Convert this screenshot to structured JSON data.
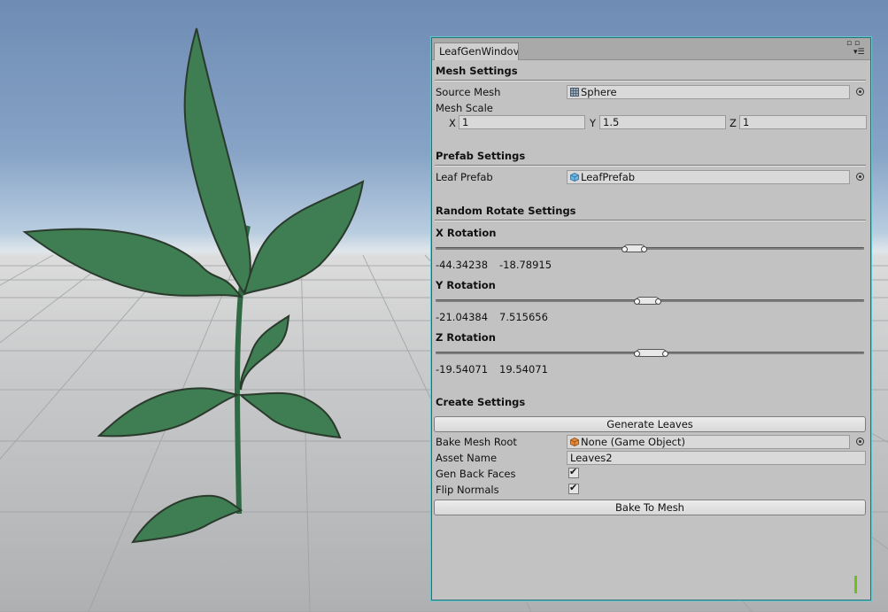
{
  "window": {
    "tab_title": "LeafGenWindov",
    "menu_icons": [
      "lock-icon",
      "maximize-icon",
      "dropdown-menu-icon"
    ]
  },
  "mesh_settings": {
    "header": "Mesh Settings",
    "source_mesh": {
      "label": "Source Mesh",
      "value": "Sphere",
      "icon": "mesh-icon"
    },
    "mesh_scale": {
      "label": "Mesh Scale",
      "x": {
        "label": "X",
        "value": "1"
      },
      "y": {
        "label": "Y",
        "value": "1.5"
      },
      "z": {
        "label": "Z",
        "value": "1"
      }
    }
  },
  "prefab_settings": {
    "header": "Prefab Settings",
    "leaf_prefab": {
      "label": "Leaf Prefab",
      "value": "LeafPrefab",
      "icon": "prefab-cube-icon"
    }
  },
  "random_rotate_settings": {
    "header": "Random Rotate Settings",
    "x_rotation": {
      "label": "X Rotation",
      "min": "-44.34238",
      "max": "-18.78915"
    },
    "y_rotation": {
      "label": "Y Rotation",
      "min": "-21.04384",
      "max": "7.515656"
    },
    "z_rotation": {
      "label": "Z Rotation",
      "min": "-19.54071",
      "max": "19.54071"
    }
  },
  "create_settings": {
    "header": "Create Settings",
    "generate_button": "Generate Leaves",
    "bake_mesh_root": {
      "label": "Bake Mesh Root",
      "value": "None (Game Object)",
      "icon": "game-object-icon"
    },
    "asset_name": {
      "label": "Asset Name",
      "value": "Leaves2"
    },
    "gen_back_faces": {
      "label": "Gen Back Faces",
      "checked": true
    },
    "flip_normals": {
      "label": "Flip Normals",
      "checked": true
    },
    "bake_button": "Bake To Mesh"
  },
  "colors": {
    "window_border": "#5fc9cf",
    "panel_bg": "#c2c2c2",
    "leaf_green": "#3e7d52"
  }
}
